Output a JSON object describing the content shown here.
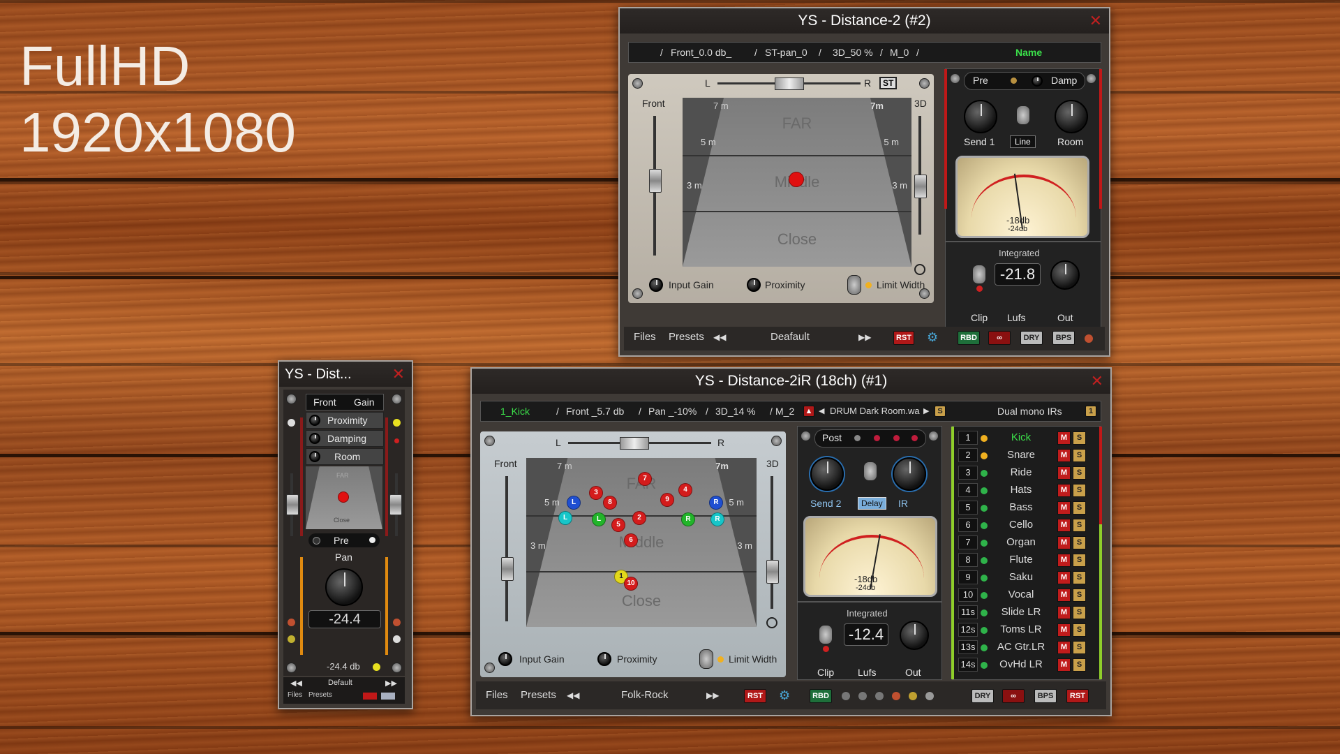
{
  "desktop": {
    "line1": "FullHD",
    "line2": "1920x1080"
  },
  "win_top": {
    "title": "YS - Distance-2 (#2)",
    "info": {
      "front": "Front_0.0 db_",
      "pan": "ST-pan_0",
      "three_d": "3D_50 %",
      "m": "M_0",
      "name": "Name"
    },
    "pan": {
      "left": "L",
      "right": "R",
      "st": "ST"
    },
    "side": {
      "front": "Front",
      "three_d": "3D"
    },
    "field": {
      "far": "FAR",
      "middle": "Middle",
      "close": "Close",
      "m7": "7 m",
      "m5": "5 m",
      "m3": "3 m",
      "m7r": "7m",
      "m5r": "5 m",
      "m3r": "3 m"
    },
    "controls": {
      "input_gain": "Input Gain",
      "proximity": "Proximity",
      "limit_width": "Limit Width"
    },
    "fx": {
      "pre": "Pre",
      "damp": "Damp",
      "send": "Send 1",
      "line": "Line",
      "room": "Room"
    },
    "meter": {
      "db": "-18db",
      "db2": "-24db",
      "needle_deg": -8
    },
    "loudness": {
      "integrated": "Integrated",
      "value": "-21.8",
      "clip": "Clip",
      "lufs": "Lufs",
      "out": "Out"
    },
    "bottom": {
      "files": "Files",
      "presets": "Presets",
      "preset_name": "Deafault",
      "rst": "RST",
      "rbd": "RBD",
      "dry": "DRY",
      "bps": "BPS",
      "prev": "◀◀",
      "next": "▶▶"
    }
  },
  "win_small": {
    "title": "YS - Dist...",
    "front": "Front",
    "gain": "Gain",
    "proximity": "Proximity",
    "damping": "Damping",
    "room": "Room",
    "far": "FAR",
    "close": "Close",
    "pre": "Pre",
    "pan": "Pan",
    "value": "-24.4",
    "db": "-24.4 db",
    "prev": "◀◀",
    "preset": "Default",
    "next": "▶▶",
    "files": "Files",
    "presets": "Presets"
  },
  "win_main": {
    "title": "YS - Distance-2iR (18ch) (#1)",
    "info": {
      "track": "1_Kick",
      "front": "Front _5.7 db",
      "pan": "Pan _-10%",
      "three_d": "3D_14 %",
      "m": "M_2",
      "ir_file": "DRUM Dark Room.wa",
      "mode": "Dual mono IRs",
      "s": "S",
      "one": "1"
    },
    "pan": {
      "left": "L",
      "right": "R"
    },
    "side": {
      "front": "Front",
      "three_d": "3D"
    },
    "field": {
      "far": "FAR",
      "middle": "Middle",
      "close": "Close",
      "m7": "7 m",
      "m5": "5 m",
      "m3": "3 m",
      "m7r": "7m",
      "m5r": "5 m",
      "m3r": "3 m"
    },
    "balls": [
      {
        "label": "7",
        "color": "#d41c1c"
      },
      {
        "label": "3",
        "color": "#d41c1c"
      },
      {
        "label": "4",
        "color": "#d41c1c"
      },
      {
        "label": "8",
        "color": "#d41c1c"
      },
      {
        "label": "9",
        "color": "#d41c1c"
      },
      {
        "label": "L",
        "color": "#1f4fd1"
      },
      {
        "label": "R",
        "color": "#1f4fd1"
      },
      {
        "label": "2",
        "color": "#d41c1c"
      },
      {
        "label": "L",
        "color": "#17c6c9"
      },
      {
        "label": "L",
        "color": "#22b52a"
      },
      {
        "label": "R",
        "color": "#22b52a"
      },
      {
        "label": "R",
        "color": "#17c6c9"
      },
      {
        "label": "5",
        "color": "#d41c1c"
      },
      {
        "label": "6",
        "color": "#d41c1c"
      },
      {
        "label": "1",
        "color": "#e3d81a"
      },
      {
        "label": "10",
        "color": "#d41c1c"
      }
    ],
    "controls": {
      "input_gain": "Input Gain",
      "proximity": "Proximity",
      "limit_width": "Limit Width"
    },
    "fx": {
      "post": "Post",
      "send": "Send 2",
      "delay": "Delay",
      "ir": "IR"
    },
    "meter": {
      "db": "-18db",
      "db2": "-24db",
      "needle_deg": 10
    },
    "loudness": {
      "integrated": "Integrated",
      "value": "-12.4",
      "clip": "Clip",
      "lufs": "Lufs",
      "out": "Out"
    },
    "tracks": [
      {
        "num": "1",
        "name": "Kick",
        "active": true
      },
      {
        "num": "2",
        "name": "Snare"
      },
      {
        "num": "3",
        "name": "Ride"
      },
      {
        "num": "4",
        "name": "Hats"
      },
      {
        "num": "5",
        "name": "Bass"
      },
      {
        "num": "6",
        "name": "Cello"
      },
      {
        "num": "7",
        "name": "Organ"
      },
      {
        "num": "8",
        "name": "Flute"
      },
      {
        "num": "9",
        "name": "Saku"
      },
      {
        "num": "10",
        "name": "Vocal"
      },
      {
        "num": "11s",
        "name": "Slide  LR"
      },
      {
        "num": "12s",
        "name": "Toms  LR"
      },
      {
        "num": "13s",
        "name": "AC Gtr.LR"
      },
      {
        "num": "14s",
        "name": "OvHd LR"
      }
    ],
    "mute": "M",
    "solo": "S",
    "bottom": {
      "files": "Files",
      "presets": "Presets",
      "preset_name": "Folk-Rock",
      "rst": "RST",
      "rbd": "RBD",
      "dry": "DRY",
      "bps": "BPS",
      "prev": "◀◀",
      "next": "▶▶"
    }
  },
  "colors": {
    "red_led": "#d02020",
    "amber_led": "#f0b020",
    "green_led": "#2fb34a",
    "name_green": "#3be04a"
  }
}
